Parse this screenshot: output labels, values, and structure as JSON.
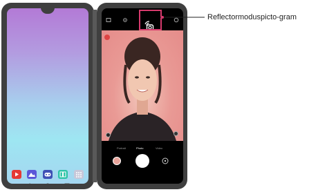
{
  "callout": {
    "label": "Reflectormoduspicto-gram"
  },
  "left_screen": {
    "apps": [
      "youtube-icon",
      "photos-icon",
      "game-launcher-icon",
      "dual-screen-icon",
      "apps-grid-icon"
    ],
    "app_colors": [
      "#e53935",
      "#5b57d8",
      "#3f51b5",
      "#2ec4a8",
      "#c7c7d9"
    ],
    "nav": [
      "back-icon",
      "home-icon",
      "recents-icon"
    ]
  },
  "camera": {
    "modes": [
      "Portrait",
      "Photo",
      "Video"
    ],
    "selected_mode": "Photo",
    "highlight_color": "#d63a6d"
  }
}
